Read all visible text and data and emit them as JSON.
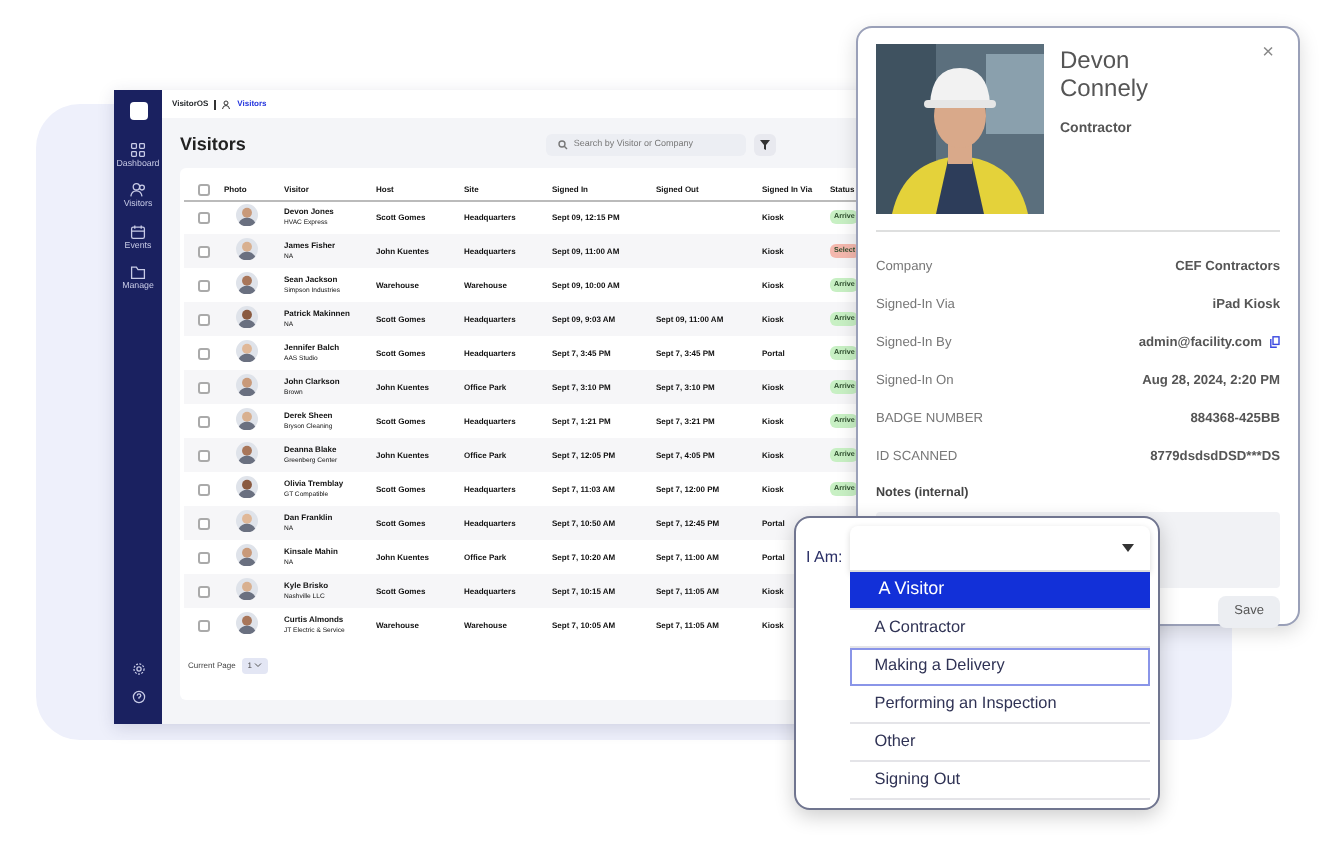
{
  "app": {
    "brand": "VisitorOS",
    "section": "Visitors",
    "title": "Visitors",
    "search": {
      "placeholder": "Search by Visitor or Company"
    },
    "sidebar": [
      {
        "label": "Dashboard"
      },
      {
        "label": "Visitors"
      },
      {
        "label": "Events"
      },
      {
        "label": "Manage"
      }
    ],
    "select_all_checked": false,
    "columns": [
      "Photo",
      "Visitor",
      "Host",
      "Site",
      "Signed In",
      "Signed Out",
      "Signed In Via",
      "Status"
    ],
    "rows": [
      {
        "checked": false,
        "name": "Devon Jones",
        "company": "HVAC Express",
        "host": "Scott Gomes",
        "site": "Headquarters",
        "signed_in": "Sept 09, 12:15 PM",
        "signed_out": "",
        "via": "Kiosk",
        "status": {
          "text": "Arrive",
          "color": "#c8f0c4"
        }
      },
      {
        "checked": false,
        "name": "James Fisher",
        "company": "NA",
        "host": "John Kuentes",
        "site": "Headquarters",
        "signed_in": "Sept 09, 11:00 AM",
        "signed_out": "",
        "via": "Kiosk",
        "status": {
          "text": "Select",
          "color": "#f4b8ae"
        }
      },
      {
        "checked": false,
        "name": "Sean Jackson",
        "company": "Simpson Industries",
        "host": "Warehouse",
        "site": "Warehouse",
        "signed_in": "Sept 09, 10:00 AM",
        "signed_out": "",
        "via": "Kiosk",
        "status": {
          "text": "Arrive",
          "color": "#c8f0c4"
        }
      },
      {
        "checked": false,
        "name": "Patrick Makinnen",
        "company": "NA",
        "host": "Scott Gomes",
        "site": "Headquarters",
        "signed_in": "Sept 09, 9:03 AM",
        "signed_out": "Sept 09, 11:00 AM",
        "via": "Kiosk",
        "status": {
          "text": "Arrive",
          "color": "#c8f0c4"
        }
      },
      {
        "checked": false,
        "name": "Jennifer Balch",
        "company": "AAS Studio",
        "host": "Scott Gomes",
        "site": "Headquarters",
        "signed_in": "Sept 7, 3:45 PM",
        "signed_out": "Sept 7, 3:45 PM",
        "via": "Portal",
        "status": {
          "text": "Arrive",
          "color": "#c8f0c4"
        }
      },
      {
        "checked": false,
        "name": "John Clarkson",
        "company": "Brown",
        "host": "John Kuentes",
        "site": "Office Park",
        "signed_in": "Sept 7, 3:10 PM",
        "signed_out": "Sept 7, 3:10 PM",
        "via": "Kiosk",
        "status": {
          "text": "Arrive",
          "color": "#c8f0c4"
        }
      },
      {
        "checked": false,
        "name": "Derek Sheen",
        "company": "Bryson Cleaning",
        "host": "Scott Gomes",
        "site": "Headquarters",
        "signed_in": "Sept 7, 1:21 PM",
        "signed_out": "Sept 7, 3:21 PM",
        "via": "Kiosk",
        "status": {
          "text": "Arrive",
          "color": "#c8f0c4"
        }
      },
      {
        "checked": false,
        "name": "Deanna Blake",
        "company": "Greenberg Center",
        "host": "John Kuentes",
        "site": "Office Park",
        "signed_in": "Sept 7, 12:05 PM",
        "signed_out": "Sept 7, 4:05 PM",
        "via": "Kiosk",
        "status": {
          "text": "Arrive",
          "color": "#c8f0c4"
        }
      },
      {
        "checked": false,
        "name": "Olivia Tremblay",
        "company": "GT Compatible",
        "host": "Scott Gomes",
        "site": "Headquarters",
        "signed_in": "Sept 7, 11:03 AM",
        "signed_out": "Sept 7, 12:00 PM",
        "via": "Kiosk",
        "status": {
          "text": "Arrive",
          "color": "#c8f0c4"
        }
      },
      {
        "checked": false,
        "name": "Dan Franklin",
        "company": "NA",
        "host": "Scott Gomes",
        "site": "Headquarters",
        "signed_in": "Sept 7, 10:50 AM",
        "signed_out": "Sept 7, 12:45 PM",
        "via": "Portal"
      },
      {
        "checked": false,
        "name": "Kinsale Mahin",
        "company": "NA",
        "host": "John Kuentes",
        "site": "Office Park",
        "signed_in": "Sept 7, 10:20 AM",
        "signed_out": "Sept 7, 11:00 AM",
        "via": "Portal"
      },
      {
        "checked": false,
        "name": "Kyle Brisko",
        "company": "Nashville LLC",
        "host": "Scott Gomes",
        "site": "Headquarters",
        "signed_in": "Sept 7, 10:15 AM",
        "signed_out": "Sept 7, 11:05 AM",
        "via": "Kiosk"
      },
      {
        "checked": false,
        "name": "Curtis Almonds",
        "company": "JT Electric & Service",
        "host": "Warehouse",
        "site": "Warehouse",
        "signed_in": "Sept 7, 10:05 AM",
        "signed_out": "Sept 7, 11:05 AM",
        "via": "Kiosk"
      }
    ],
    "pager": {
      "label": "Current Page",
      "value": "1"
    }
  },
  "detail": {
    "name": "Devon Connely",
    "role": "Contractor",
    "close": "×",
    "fields": [
      {
        "label": "Company",
        "value": "CEF Contractors",
        "copyable": false
      },
      {
        "label": "Signed-In Via",
        "value": "iPad Kiosk",
        "copyable": false
      },
      {
        "label": "Signed-In By",
        "value": "admin@facility.com",
        "copyable": true
      },
      {
        "label": "Signed-In On",
        "value": "Aug 28, 2024, 2:20 PM",
        "copyable": false
      },
      {
        "label": "BADGE NUMBER",
        "value": "884368-425BB",
        "copyable": false
      },
      {
        "label": "ID SCANNED",
        "value": "8779dsdsdDSD***DS",
        "copyable": false
      }
    ],
    "notes_label": "Notes (internal)",
    "save": "Save"
  },
  "picker": {
    "label": "I Am:",
    "options": [
      {
        "text": "A Visitor",
        "selected": true,
        "focused": false
      },
      {
        "text": "A Contractor",
        "selected": false,
        "focused": false
      },
      {
        "text": "Making a Delivery",
        "selected": false,
        "focused": true
      },
      {
        "text": "Performing an Inspection",
        "selected": false,
        "focused": false
      },
      {
        "text": "Other",
        "selected": false,
        "focused": false
      },
      {
        "text": "Signing Out",
        "selected": false,
        "focused": false
      }
    ]
  }
}
